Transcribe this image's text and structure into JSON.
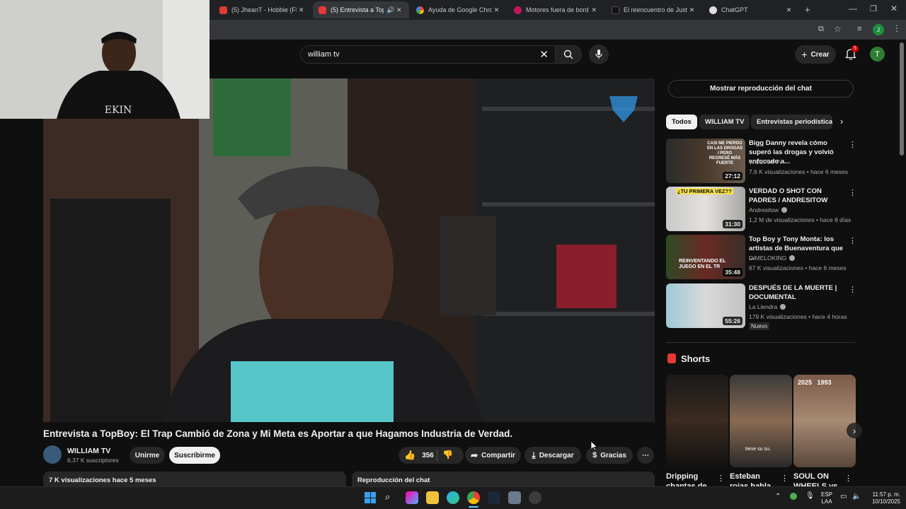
{
  "browser": {
    "tabs": [
      {
        "label": "(5) JheanT - Hobbie (FREE",
        "icon": "youtube-icon"
      },
      {
        "label": "(5) Entrevista a TopBo",
        "icon": "youtube-icon",
        "active": true
      },
      {
        "label": "Ayuda de Google Chrome",
        "icon": "google-icon"
      },
      {
        "label": "Motores fuera de borda -",
        "icon": "site-icon"
      },
      {
        "label": "El reencuentro de Justin y",
        "icon": "tiktok-icon"
      },
      {
        "label": "ChatGPT",
        "icon": "chatgpt-icon"
      }
    ],
    "profile_initial": "J"
  },
  "header": {
    "search_value": "william tv",
    "create_label": "Crear",
    "notifications_count": "5",
    "avatar_initial": "T"
  },
  "video": {
    "title": "Entrevista a TopBoy: El Trap Cambió de Zona y Mi Meta es Aportar a que Hagamos Industria de Verdad.",
    "channel": "WILLIAM TV",
    "subscribers": "6,37 K suscriptores",
    "join_label": "Unirme",
    "subscribe_label": "Suscribirme",
    "likes": "356",
    "share_label": "Compartir",
    "download_label": "Descargar",
    "thanks_label": "Gracias",
    "views_date": "7 K visualizaciones  hace 5 meses",
    "chat_replay_label": "Reproducción del chat"
  },
  "sidebar": {
    "show_chat_label": "Mostrar reproducción del chat",
    "chips": [
      "Todos",
      "WILLIAM TV",
      "Entrevistas periodísticas"
    ],
    "recommendations": [
      {
        "title": "Bigg Danny revela cómo superó las drogas y volvió enfocado a...",
        "channel": "WILLIAM TV",
        "meta": "7,6 K visualizaciones • hace 6 meses",
        "duration": "27:12",
        "verified": false,
        "thumb_text": "CASI ME PIERDO EN LAS DROGAS / PERO REGRESÉ MÁS FUERTE"
      },
      {
        "title": "VERDAD O SHOT CON PADRES / ANDRESITOW",
        "channel": "Andresitow",
        "meta": "1,2 M de visualizaciones • hace 8 días",
        "duration": "31:30",
        "verified": true,
        "thumb_text": "¿TU PRIMERA VEZ??"
      },
      {
        "title": "Top Boy y Tony Monta: los artistas de Buenaventura que ...",
        "channel": "DIMELOKING",
        "meta": "67 K visualizaciones • hace 6 meses",
        "duration": "35:48",
        "verified": true,
        "thumb_text": "REINVENTANDO EL JUEGO EN EL TR"
      },
      {
        "title": "DESPUÉS DE LA MUERTE | DOCUMENTAL",
        "channel": "La Liendra",
        "meta": "179 K visualizaciones • hace 4 horas",
        "duration": "55:26",
        "verified": true,
        "badge": "Nuevo",
        "thumb_text": ""
      }
    ],
    "shorts_label": "Shorts",
    "shorts": [
      {
        "title": "Dripping chantas de",
        "overlay": ""
      },
      {
        "title": "Esteban rojas habla",
        "overlay": "tiene su su."
      },
      {
        "title": "SOUL ON WHEELS vs",
        "overlay": "2025   1993"
      }
    ]
  },
  "taskbar": {
    "lang": "ESP",
    "lang2": "LAA",
    "time": "11:57 p. m.",
    "date": "10/10/2025"
  }
}
